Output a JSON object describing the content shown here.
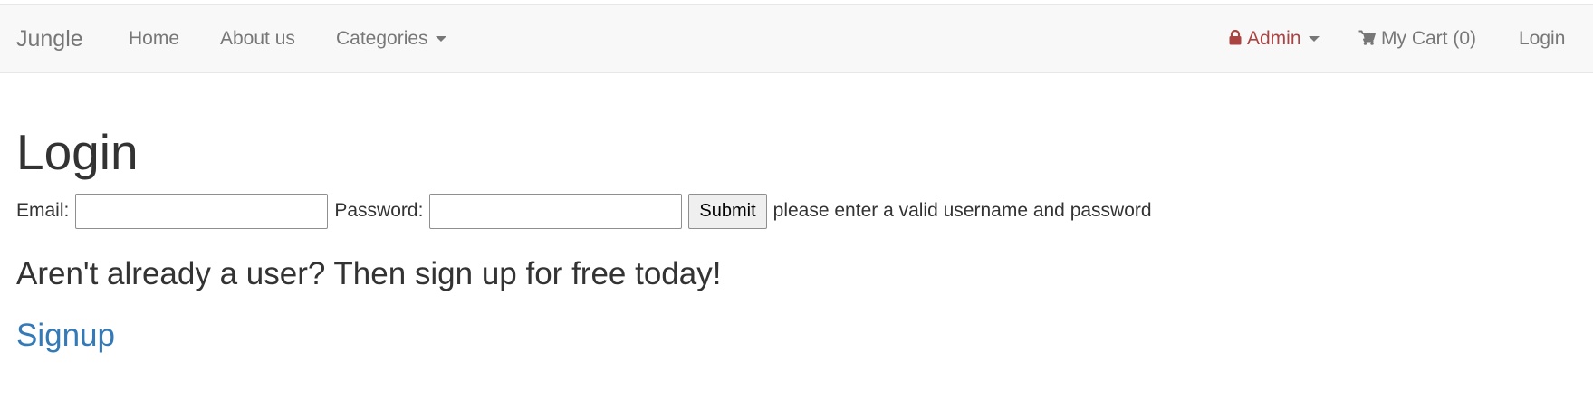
{
  "navbar": {
    "brand": "Jungle",
    "home": "Home",
    "about": "About us",
    "categories": "Categories",
    "admin": "Admin",
    "cart": "My Cart (0)",
    "login": "Login",
    "admin_color": "#a94442"
  },
  "main": {
    "title": "Login",
    "email_label": "Email:",
    "email_value": "",
    "password_label": "Password:",
    "password_value": "",
    "submit_label": "Submit",
    "error_message": "please enter a valid username and password",
    "signup_prompt": "Aren't already a user? Then sign up for free today!",
    "signup_link": "Signup",
    "link_color": "#337ab7"
  },
  "icons": {
    "admin": "lock-icon",
    "cart": "shopping-cart-icon",
    "dropdown": "caret-down-icon"
  }
}
